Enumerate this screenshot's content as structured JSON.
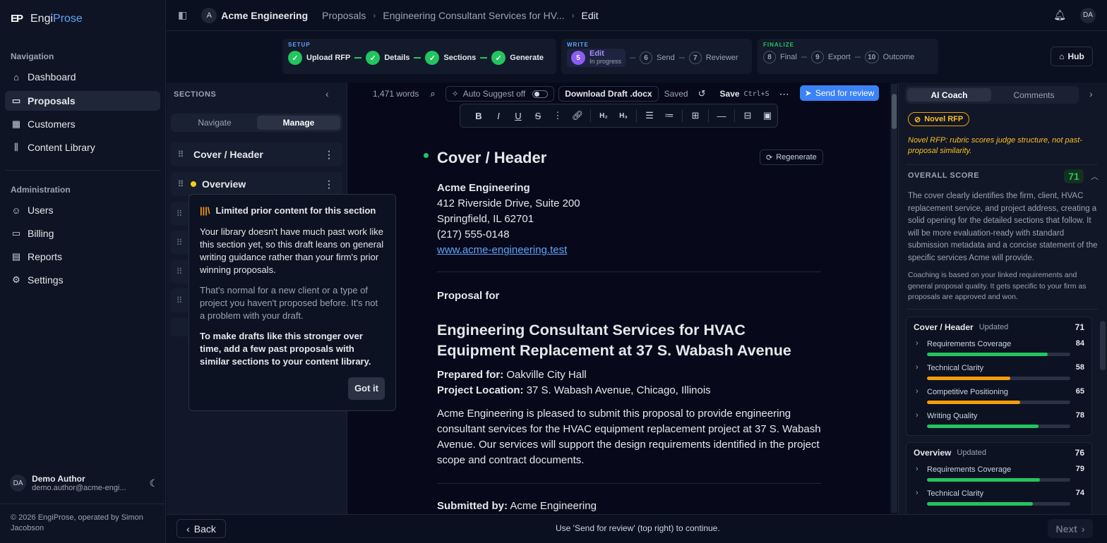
{
  "app": {
    "name_a": "Engi",
    "name_b": "Prose",
    "logo_text": "EP"
  },
  "sidebar": {
    "nav_title": "Navigation",
    "nav_items": [
      {
        "label": "Dashboard",
        "icon": "home-icon"
      },
      {
        "label": "Proposals",
        "icon": "file-icon",
        "active": true
      },
      {
        "label": "Customers",
        "icon": "building-icon"
      },
      {
        "label": "Content Library",
        "icon": "library-icon"
      }
    ],
    "admin_title": "Administration",
    "admin_items": [
      {
        "label": "Users",
        "icon": "users-icon"
      },
      {
        "label": "Billing",
        "icon": "card-icon"
      },
      {
        "label": "Reports",
        "icon": "reports-icon"
      },
      {
        "label": "Settings",
        "icon": "gear-icon"
      }
    ],
    "user": {
      "initials": "DA",
      "name": "Demo Author",
      "email": "demo.author@acme-engi..."
    },
    "copyright": "© 2026 EngiProse, operated by Simon Jacobson"
  },
  "topbar": {
    "workspace_initial": "A",
    "workspace": "Acme Engineering",
    "crumb1": "Proposals",
    "crumb2": "Engineering Consultant Services for HV...",
    "crumb3": "Edit",
    "user_initials": "DA"
  },
  "stepper": {
    "setup_label": "SETUP",
    "setup_steps": [
      "Upload RFP",
      "Details",
      "Sections",
      "Generate"
    ],
    "write_label": "WRITE",
    "current": {
      "num": "5",
      "name": "Edit",
      "status": "In progress"
    },
    "write_steps": [
      {
        "num": "6",
        "name": "Send"
      },
      {
        "num": "7",
        "name": "Reviewer"
      }
    ],
    "finalize_label": "FINALIZE",
    "final_steps": [
      {
        "num": "8",
        "name": "Final"
      },
      {
        "num": "9",
        "name": "Export"
      },
      {
        "num": "10",
        "name": "Outcome"
      }
    ],
    "hub": "Hub"
  },
  "sections_panel": {
    "title": "SECTIONS",
    "tab_navigate": "Navigate",
    "tab_manage": "Manage",
    "rows": [
      "Cover / Header",
      "Overview"
    ]
  },
  "popover": {
    "title": "Limited prior content for this section",
    "p1": "Your library doesn't have much past work like this section yet, so this draft leans on general writing guidance rather than your firm's prior winning proposals.",
    "p2": "That's normal for a new client or a type of project you haven't proposed before. It's not a problem with your draft.",
    "p3": "To make drafts like this stronger over time, add a few past proposals with similar sections to your content library.",
    "button": "Got it"
  },
  "editor": {
    "word_count": "1,471 words",
    "auto_suggest": "Auto Suggest off",
    "download": "Download Draft .docx",
    "saved": "Saved",
    "save": "Save",
    "save_shortcut": "Ctrl+S",
    "send_review": "Send for review",
    "regenerate": "Regenerate",
    "doc": {
      "section_title": "Cover / Header",
      "firm": "Acme Engineering",
      "addr1": "412 Riverside Drive, Suite 200",
      "addr2": "Springfield, IL 62701",
      "phone": "(217) 555-0148",
      "web": "www.acme-engineering.test",
      "proposal_for": "Proposal for",
      "headline": "Engineering Consultant Services for HVAC Equipment Replacement at 37 S. Wabash Avenue",
      "prepared_label": "Prepared for:",
      "prepared_value": "Oakville City Hall",
      "location_label": "Project Location:",
      "location_value": "37 S. Wabash Avenue, Chicago, Illinois",
      "intro": "Acme Engineering is pleased to submit this proposal to provide engineering consultant services for the HVAC equipment replacement project at 37 S. Wabash Avenue. Our services will support the design requirements identified in the project scope and contract documents.",
      "submitted_label": "Submitted by:",
      "submitted_value": "Acme Engineering"
    }
  },
  "coach": {
    "tab_ai": "AI Coach",
    "tab_comments": "Comments",
    "badge": "Novel RFP",
    "notice": "Novel RFP: rubric scores judge structure, not past-proposal similarity.",
    "overall_label": "OVERALL SCORE",
    "overall_score": "71",
    "summary": "The cover clearly identifies the firm, client, HVAC replacement service, and project address, creating a solid opening for the detailed sections that follow. It will be more evaluation-ready with standard submission metadata and a concise statement of the specific services Acme will provide.",
    "note": "Coaching is based on your linked requirements and general proposal quality. It gets specific to your firm as proposals are approved and won.",
    "cards": [
      {
        "title": "Cover / Header",
        "status": "Updated",
        "score": "71",
        "metrics": [
          {
            "name": "Requirements Coverage",
            "value": 84,
            "color": "#22c55e"
          },
          {
            "name": "Technical Clarity",
            "value": 58,
            "color": "#f59e0b"
          },
          {
            "name": "Competitive Positioning",
            "value": 65,
            "color": "#f59e0b"
          },
          {
            "name": "Writing Quality",
            "value": 78,
            "color": "#22c55e"
          }
        ]
      },
      {
        "title": "Overview",
        "status": "Updated",
        "score": "76",
        "metrics": [
          {
            "name": "Requirements Coverage",
            "value": 79,
            "color": "#22c55e"
          },
          {
            "name": "Technical Clarity",
            "value": 74,
            "color": "#22c55e"
          }
        ]
      }
    ]
  },
  "bottom": {
    "back": "Back",
    "hint": "Use 'Send for review' (top right) to continue.",
    "next": "Next"
  }
}
